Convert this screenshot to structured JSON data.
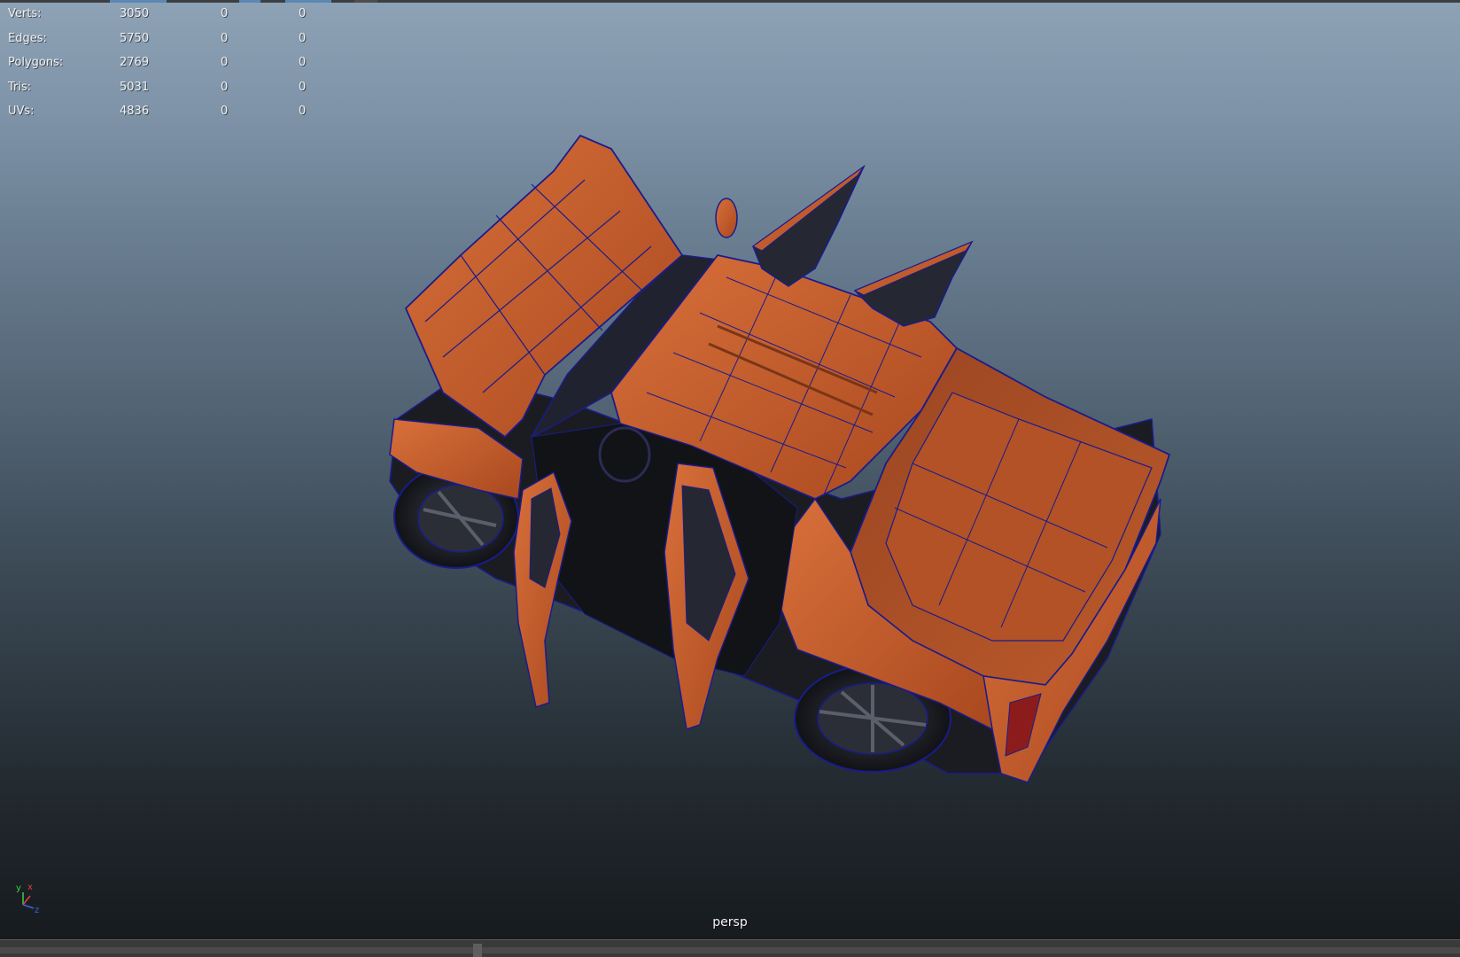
{
  "hud": {
    "rows": [
      {
        "label": "Verts:",
        "total": "3050",
        "selected": "0",
        "uv": "0"
      },
      {
        "label": "Edges:",
        "total": "5750",
        "selected": "0",
        "uv": "0"
      },
      {
        "label": "Polygons:",
        "total": "2769",
        "selected": "0",
        "uv": "0"
      },
      {
        "label": "Tris:",
        "total": "5031",
        "selected": "0",
        "uv": "0"
      },
      {
        "label": "UVs:",
        "total": "4836",
        "selected": "0",
        "uv": "0"
      }
    ]
  },
  "viewport": {
    "camera_label": "persp"
  },
  "axis": {
    "x_label": "x",
    "y_label": "y",
    "z_label": "z"
  },
  "colors": {
    "model_body": "#c9602d",
    "model_body_shadow": "#8c3f1f",
    "model_dark": "#1b1d22",
    "wireframe": "#1a1c8c",
    "axis_x": "#e04040",
    "axis_y": "#40d040",
    "axis_z": "#4060e0"
  },
  "toolbar": {
    "tick_colors": [
      "#5b88b5",
      "#5b88b5",
      "#4d4d4d",
      "#4d4d4d"
    ]
  }
}
